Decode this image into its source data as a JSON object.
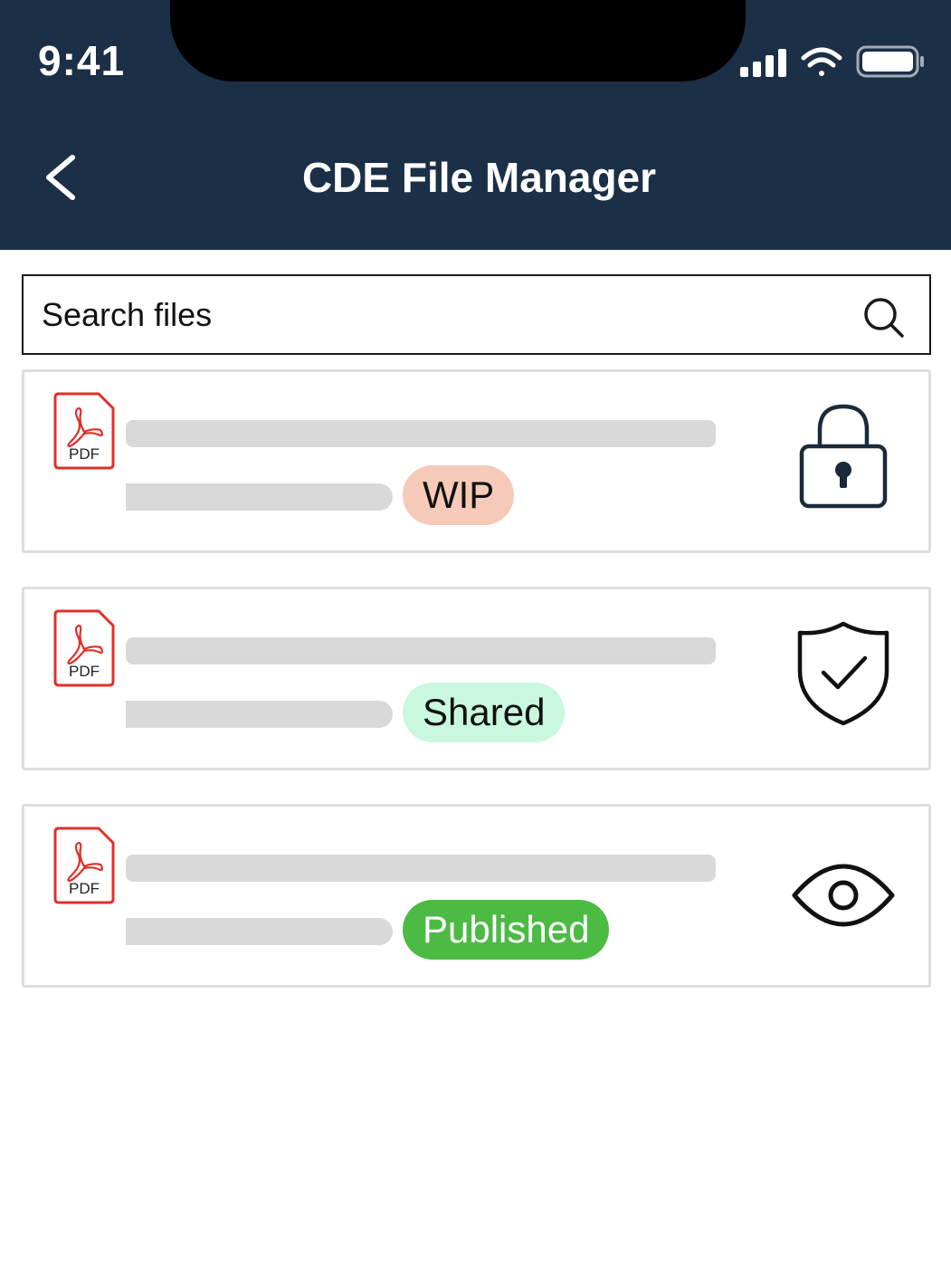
{
  "status_bar": {
    "time": "9:41"
  },
  "header": {
    "title": "CDE File Manager",
    "back_icon": "chevron-left-icon"
  },
  "search": {
    "placeholder": "Search files",
    "value": "",
    "icon": "search-icon"
  },
  "files": [
    {
      "type_label": "PDF",
      "status": "WIP",
      "status_color": "#f6c9b8",
      "action_icon": "lock-icon"
    },
    {
      "type_label": "PDF",
      "status": "Shared",
      "status_color": "#c9f8df",
      "action_icon": "shield-check-icon"
    },
    {
      "type_label": "PDF",
      "status": "Published",
      "status_color": "#4cbb44",
      "action_icon": "eye-icon"
    }
  ],
  "colors": {
    "header_bg": "#1b3046",
    "pdf_red": "#e0302a",
    "icon_stroke": "#1b2a3a"
  }
}
